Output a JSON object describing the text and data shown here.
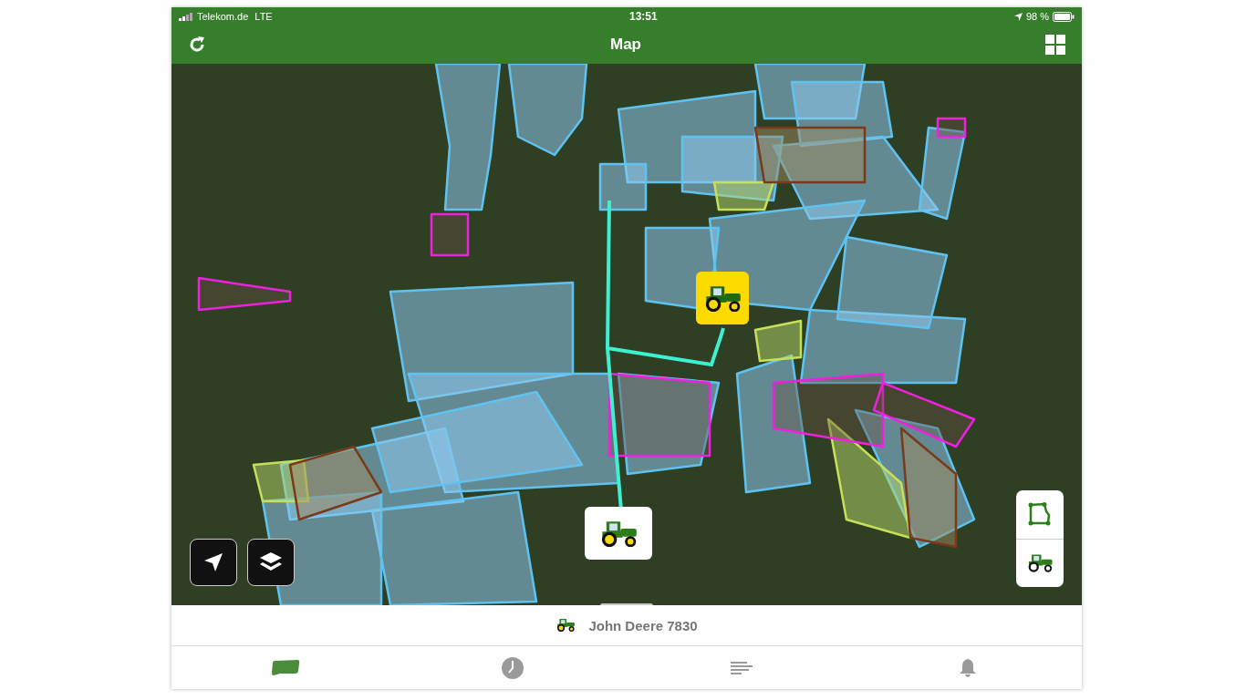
{
  "status_bar": {
    "carrier": "Telekom.de",
    "network": "LTE",
    "time": "13:51",
    "battery": "98 %"
  },
  "nav_bar": {
    "title": "Map"
  },
  "map": {
    "markers": [
      {
        "kind": "tractor",
        "selected": true
      },
      {
        "kind": "tractor",
        "selected": false
      }
    ]
  },
  "bottom_sheet": {
    "machine": "John Deere 7830"
  },
  "tabs": [
    {
      "kind": "fields",
      "selected": true
    },
    {
      "kind": "history",
      "selected": false
    },
    {
      "kind": "list",
      "selected": false
    },
    {
      "kind": "alerts",
      "selected": false
    }
  ]
}
